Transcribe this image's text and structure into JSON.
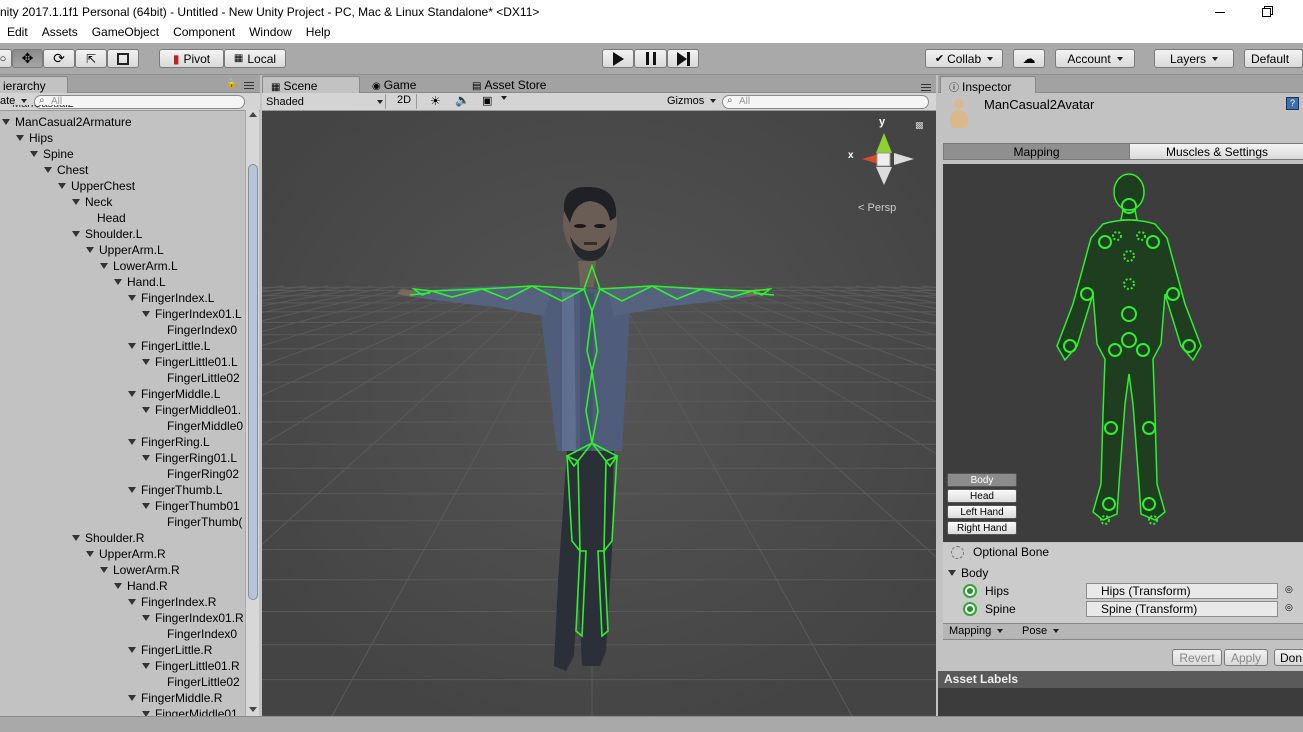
{
  "window": {
    "title": "nity 2017.1.1f1 Personal (64bit) - Untitled - New Unity Project - PC, Mac & Linux Standalone* <DX11>"
  },
  "menu": [
    "Edit",
    "Assets",
    "GameObject",
    "Component",
    "Window",
    "Help"
  ],
  "toolbar": {
    "pivot": "Pivot",
    "local": "Local",
    "collab": "Collab",
    "account": "Account",
    "layers": "Layers",
    "layout": "Default"
  },
  "hierarchy": {
    "tab": "ierarchy",
    "create": "ate",
    "search_placeholder": "All",
    "rows": [
      {
        "label": "ManCasual2Armature",
        "depth": 0
      },
      {
        "label": "Hips",
        "depth": 1
      },
      {
        "label": "Spine",
        "depth": 2
      },
      {
        "label": "Chest",
        "depth": 3
      },
      {
        "label": "UpperChest",
        "depth": 4
      },
      {
        "label": "Neck",
        "depth": 5
      },
      {
        "label": "Head",
        "depth": 6,
        "leaf": true
      },
      {
        "label": "Shoulder.L",
        "depth": 5
      },
      {
        "label": "UpperArm.L",
        "depth": 6
      },
      {
        "label": "LowerArm.L",
        "depth": 7
      },
      {
        "label": "Hand.L",
        "depth": 8
      },
      {
        "label": "FingerIndex.L",
        "depth": 9
      },
      {
        "label": "FingerIndex01.L",
        "depth": 10
      },
      {
        "label": "FingerIndex0",
        "depth": 11,
        "leaf": true
      },
      {
        "label": "FingerLittle.L",
        "depth": 9
      },
      {
        "label": "FingerLittle01.L",
        "depth": 10
      },
      {
        "label": "FingerLittle02",
        "depth": 11,
        "leaf": true
      },
      {
        "label": "FingerMiddle.L",
        "depth": 9
      },
      {
        "label": "FingerMiddle01.",
        "depth": 10
      },
      {
        "label": "FingerMiddle0",
        "depth": 11,
        "leaf": true
      },
      {
        "label": "FingerRing.L",
        "depth": 9
      },
      {
        "label": "FingerRing01.L",
        "depth": 10
      },
      {
        "label": "FingerRing02",
        "depth": 11,
        "leaf": true
      },
      {
        "label": "FingerThumb.L",
        "depth": 9
      },
      {
        "label": "FingerThumb01",
        "depth": 10
      },
      {
        "label": "FingerThumb(",
        "depth": 11,
        "leaf": true
      },
      {
        "label": "Shoulder.R",
        "depth": 5
      },
      {
        "label": "UpperArm.R",
        "depth": 6
      },
      {
        "label": "LowerArm.R",
        "depth": 7
      },
      {
        "label": "Hand.R",
        "depth": 8
      },
      {
        "label": "FingerIndex.R",
        "depth": 9
      },
      {
        "label": "FingerIndex01.R",
        "depth": 10
      },
      {
        "label": "FingerIndex0",
        "depth": 11,
        "leaf": true
      },
      {
        "label": "FingerLittle.R",
        "depth": 9
      },
      {
        "label": "FingerLittle01.R",
        "depth": 10
      },
      {
        "label": "FingerLittle02",
        "depth": 11,
        "leaf": true
      },
      {
        "label": "FingerMiddle.R",
        "depth": 9
      },
      {
        "label": "FingerMiddle01.",
        "depth": 10
      }
    ]
  },
  "scene": {
    "tabs": {
      "scene": "Scene",
      "game": "Game",
      "asset_store": "Asset Store"
    },
    "shading_mode": "Shaded",
    "mode_2d": "2D",
    "gizmos": "Gizmos",
    "search_placeholder": "All",
    "gizmo": {
      "y": "y",
      "x": "x",
      "persp": "Persp"
    }
  },
  "inspector": {
    "tab": "Inspector",
    "object_name": "ManCasual2Avatar",
    "tabs": {
      "mapping": "Mapping",
      "muscles": "Muscles & Settings"
    },
    "body_buttons": [
      "Body",
      "Head",
      "Left Hand",
      "Right Hand"
    ],
    "optional_bone": "Optional Bone",
    "section": "Body",
    "bones": [
      {
        "name": "Hips",
        "value": "Hips (Transform)"
      },
      {
        "name": "Spine",
        "value": "Spine (Transform)"
      }
    ],
    "footer_menus": {
      "mapping": "Mapping",
      "pose": "Pose"
    },
    "revert": "Revert",
    "apply": "Apply",
    "done": "Don",
    "asset_labels": "Asset Labels"
  },
  "colors": {
    "bone_green": "#2ef02e",
    "selection_blue": "#3e7de0"
  }
}
